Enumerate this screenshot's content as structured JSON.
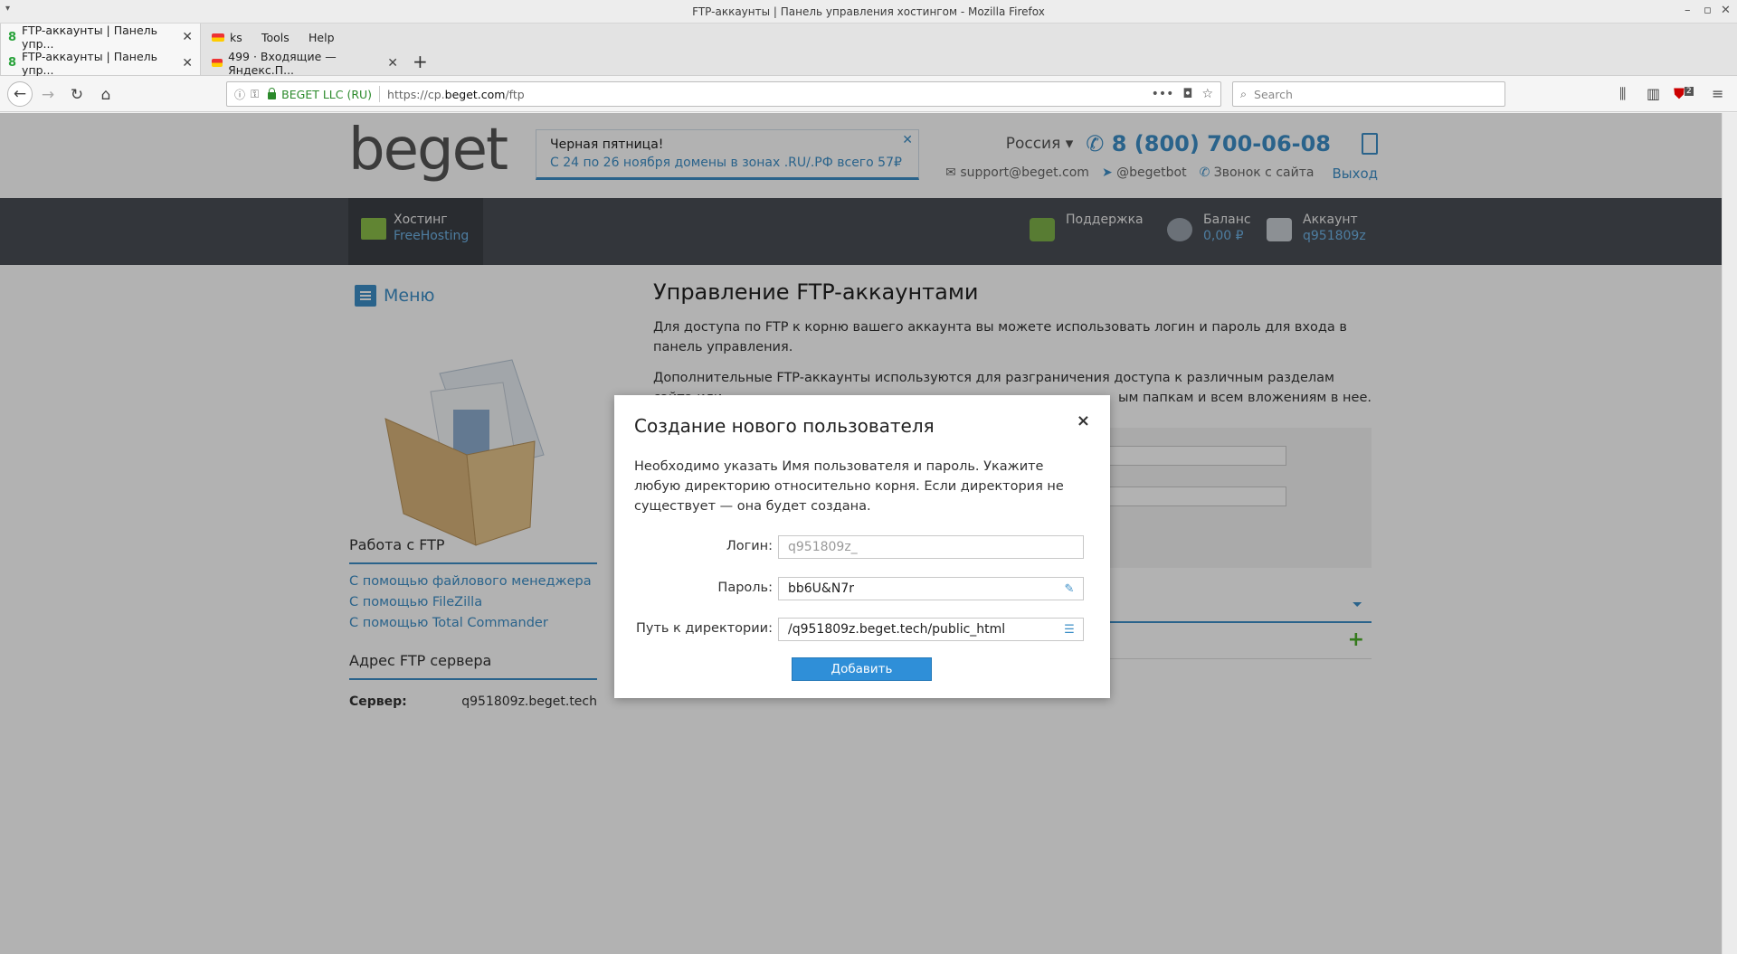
{
  "window": {
    "title": "FTP-аккаунты | Панель управления хостингом - Mozilla Firefox"
  },
  "tabs": [
    {
      "label": "FTP-аккаунты | Панель упр..."
    },
    {
      "label": "499 · Входящие — Яндекс.П..."
    }
  ],
  "menubar": {
    "items": [
      "ks",
      "Tools",
      "Help"
    ]
  },
  "urlbar": {
    "identity": "BEGET LLC (RU)",
    "url_prefix": "https://cp.",
    "url_host": "beget.com",
    "url_path": "/ftp"
  },
  "searchbar": {
    "placeholder": "Search"
  },
  "toolbar": {
    "ublock_badge": "2"
  },
  "site": {
    "logo": "beget",
    "promo": {
      "title": "Черная пятница!",
      "text": "С 24 по 26 ноября домены в зонах .RU/.РФ всего 57₽"
    },
    "region": "Россия ▾",
    "phone": "8 (800) 700-06-08",
    "email": "support@beget.com",
    "telegram": "@begetbot",
    "call": "Звонок с сайта",
    "exit": "Выход"
  },
  "topnav": {
    "hosting": {
      "title": "Хостинг",
      "plan": "FreeHosting"
    },
    "support": {
      "title": "Поддержка"
    },
    "balance": {
      "title": "Баланс",
      "value": "0,00 ₽"
    },
    "account": {
      "title": "Аккаунт",
      "value": "q951809z"
    }
  },
  "sidebar": {
    "menu": "Меню",
    "ftp_heading": "Работа с FTP",
    "links": [
      "С помощью файлового менеджера",
      "С помощью FileZilla",
      "С помощью Total Commander"
    ],
    "server_heading": "Адрес FTP сервера",
    "server_label": "Сервер:",
    "server_value": "q951809z.beget.tech"
  },
  "main": {
    "title": "Управление FTP-аккаунтами",
    "p1": "Для доступа по FTP к корню вашего аккаунта вы можете использовать логин и пароль для входа в панель управления.",
    "p2": "Дополнительные FTP-аккаунты используются для разграничения доступа к различным разделам сайта или",
    "p2_tail": "ым папкам и всем вложениям в нее."
  },
  "modal": {
    "title": "Создание нового пользователя",
    "description": "Необходимо указать Имя пользователя и пароль. Укажите любую директорию относительно корня. Если директория не существует — она будет создана.",
    "login_label": "Логин:",
    "login_placeholder": "q951809z_",
    "password_label": "Пароль:",
    "password_value": "bb6U&N7r",
    "path_label": "Путь к директории:",
    "path_value": "/q951809z.beget.tech/public_html",
    "submit": "Добавить"
  }
}
